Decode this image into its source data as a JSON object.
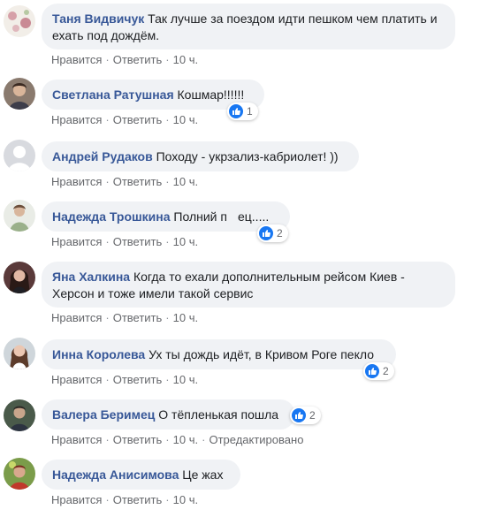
{
  "comments": [
    {
      "author": "Таня Видвичук",
      "text": "Так лучше за поездом идти пешком чем платить и ехать под дождём.",
      "like": "Нравится",
      "reply": "Ответить",
      "time": "10 ч."
    },
    {
      "author": "Светлана Ратушная",
      "text": "Кошмар!!!!!!",
      "like": "Нравится",
      "reply": "Ответить",
      "time": "10 ч.",
      "reactions": "1"
    },
    {
      "author": "Андрей Рудаков",
      "text": "Походу - укрзализ-кабриолет! ))",
      "like": "Нравится",
      "reply": "Ответить",
      "time": "10 ч."
    },
    {
      "author": "Надежда Трошкина",
      "text_before": "Полний п",
      "text_after": "ец.....",
      "like": "Нравится",
      "reply": "Ответить",
      "time": "10 ч.",
      "reactions": "2"
    },
    {
      "author": "Яна Халкина",
      "text": "Когда то ехали дополнительным рейсом Киев - Херсон и тоже имели такой сервис",
      "like": "Нравится",
      "reply": "Ответить",
      "time": "10 ч."
    },
    {
      "author": "Инна Королева",
      "text": "Ух ты дождь идёт, в Кривом Роге пекло",
      "like": "Нравится",
      "reply": "Ответить",
      "time": "10 ч.",
      "reactions": "2"
    },
    {
      "author": "Валера Беримец",
      "text": "О тёпленькая пошла",
      "like": "Нравится",
      "reply": "Ответить",
      "time": "10 ч.",
      "edited": "Отредактировано",
      "reactions": "2"
    },
    {
      "author": "Надежда Анисимова",
      "text": "Це жах",
      "like": "Нравится",
      "reply": "Ответить",
      "time": "10 ч."
    }
  ],
  "icons": {
    "like_reaction": "thumbs-up-icon"
  },
  "colors": {
    "author": "#385898",
    "bubble": "#f0f2f5",
    "meta": "#65676b",
    "like_blue": "#1877f2"
  }
}
